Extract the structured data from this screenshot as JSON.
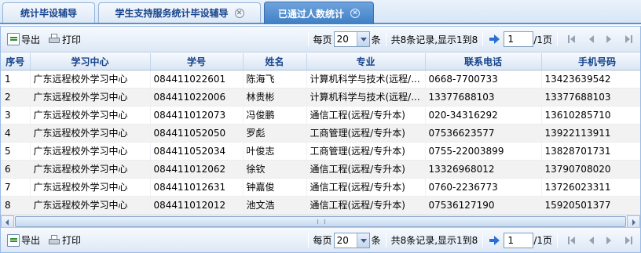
{
  "tabs": [
    {
      "label": "统计毕设辅导",
      "closable": false,
      "active": false
    },
    {
      "label": "学生支持服务统计毕设辅导",
      "closable": true,
      "active": false
    },
    {
      "label": "已通过人数统计",
      "closable": true,
      "active": true
    }
  ],
  "toolbar": {
    "export_label": "导出",
    "print_label": "打印",
    "per_page_prefix": "每页",
    "per_page_value": "20",
    "per_page_suffix": "条",
    "record_info": "共8条记录,显示1到8",
    "page_value": "1",
    "page_total": "/1页"
  },
  "table": {
    "columns": [
      "序号",
      "学习中心",
      "学号",
      "姓名",
      "专业",
      "联系电话",
      "手机号码"
    ],
    "rows": [
      [
        "1",
        "广东远程校外学习中心",
        "084411022601",
        "陈海飞",
        "计算机科学与技术(远程/...",
        "0668-7700733",
        "13423639542"
      ],
      [
        "2",
        "广东远程校外学习中心",
        "084411022006",
        "林贵彬",
        "计算机科学与技术(远程/...",
        "13377688103",
        "13377688103"
      ],
      [
        "3",
        "广东远程校外学习中心",
        "084411012073",
        "冯俊鹏",
        "通信工程(远程/专升本)",
        "020-34316292",
        "13610285710"
      ],
      [
        "4",
        "广东远程校外学习中心",
        "084411052050",
        "罗彪",
        "工商管理(远程/专升本)",
        "07536623577",
        "13922113911"
      ],
      [
        "5",
        "广东远程校外学习中心",
        "084411052034",
        "叶俊志",
        "工商管理(远程/专升本)",
        "0755-22003899",
        "13828701731"
      ],
      [
        "6",
        "广东远程校外学习中心",
        "084411012062",
        "徐钦",
        "通信工程(远程/专升本)",
        "13326968012",
        "13790708020"
      ],
      [
        "7",
        "广东远程校外学习中心",
        "084411012631",
        "钟嘉俊",
        "通信工程(远程/专升本)",
        "0760-2236773",
        "13726023311"
      ],
      [
        "8",
        "广东远程校外学习中心",
        "084411012012",
        "池文浩",
        "通信工程(远程/专升本)",
        "07536127190",
        "15920501377"
      ]
    ]
  },
  "colors": {
    "accent": "#15428b",
    "active_tab": "#4f8ed1"
  },
  "icons": [
    "export-icon",
    "print-icon",
    "close-icon",
    "dropdown-arrow-icon",
    "go-icon",
    "first-page-icon",
    "prev-page-icon",
    "next-page-icon",
    "last-page-icon"
  ]
}
